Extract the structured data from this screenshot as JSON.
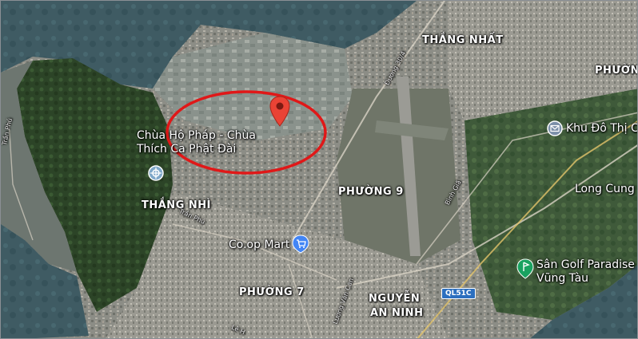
{
  "map": {
    "districts": {
      "thang_nhat": "THẮNG NHẤT",
      "phuong_top": "PHƯỜNG",
      "thang_nhi": "THẮNG NHÌ",
      "phuong_9": "PHƯỜNG 9",
      "phuong_7": "PHƯỜNG 7",
      "nguyen_line1": "NGUYỄN",
      "nguyen_line2": "AN NINH"
    },
    "pois": {
      "chua_line1": "Chùa Hộ Pháp - Chùa",
      "chua_line2": "Thích Ca Phật Đài",
      "coop": "Co.op Mart",
      "khu_do_thi": "Khu Đô Thị C",
      "long_cung": "Long Cung",
      "golf_line1": "Sân Golf Paradise",
      "golf_line2": "Vũng Tàu"
    },
    "roads": {
      "tran_phu_1": "Trần Phú",
      "tran_phu_2": "Trần Phú",
      "duong_30_4": "Đường 30/4",
      "binh_gia": "Bình Giã",
      "luong_van_can": "Lương Văn Can",
      "le_hong": "Lê H"
    },
    "route_shield": "QL51C",
    "colors": {
      "highlight_ellipse": "#e01818",
      "pin": "#ea4335",
      "water": "#3e5a63",
      "land": "#4a5549"
    }
  }
}
